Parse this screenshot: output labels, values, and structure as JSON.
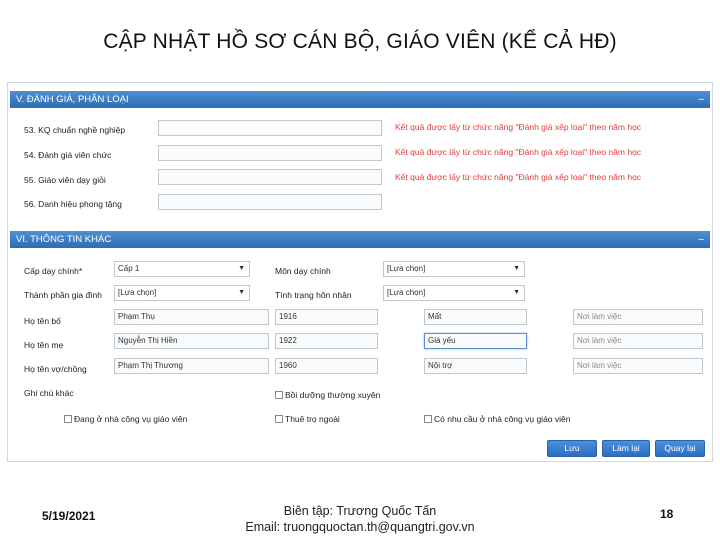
{
  "slide": {
    "title": "CẬP NHẬT HỒ SƠ CÁN BỘ, GIÁO VIÊN (KỂ CẢ HĐ)",
    "footer_date": "5/19/2021",
    "footer_editor": "Biên tập: Trương Quốc Tấn",
    "footer_email": "Email: truongquoctan.th@quangtri.gov.vn",
    "page_number": "18"
  },
  "section5": {
    "title": "V. ĐÁNH GIÁ, PHÂN LOẠI",
    "collapse": "–",
    "fields": [
      {
        "label": "53. KQ chuẩn nghề nghiệp",
        "note": "Kết quả được lấy từ chức năng \"Đánh giá xếp loại\" theo năm học"
      },
      {
        "label": "54. Đánh giá viên chức",
        "note": "Kết quả được lấy từ chức năng \"Đánh giá xếp loại\" theo năm học"
      },
      {
        "label": "55. Giáo viên dạy giỏi",
        "note": "Kết quả được lấy từ chức năng \"Đánh giá xếp loại\" theo năm học"
      },
      {
        "label": "56. Danh hiệu phong tặng",
        "note": ""
      }
    ]
  },
  "section6": {
    "title": "VI. THÔNG TIN KHÁC",
    "collapse": "–",
    "left_selects": [
      {
        "label": "Cấp dạy chính*",
        "value": "Cấp 1"
      },
      {
        "label": "Thành phần gia đình",
        "value": "[Lựa chọn]"
      }
    ],
    "right_selects": [
      {
        "label": "Môn dạy chính",
        "value": "[Lựa chọn]"
      },
      {
        "label": "Tình trạng hôn nhân",
        "value": "[Lựa chọn]"
      }
    ],
    "family": [
      {
        "label": "Họ tên bố",
        "name": "Phạm Thụ",
        "year": "1916",
        "status": "Mất",
        "work_placeholder": "Nơi làm việc"
      },
      {
        "label": "Họ tên mẹ",
        "name": "Nguyễn Thị Hiền",
        "year": "1922",
        "status": "Già yếu",
        "work_placeholder": "Nơi làm việc"
      },
      {
        "label": "Họ tên vợ/chồng",
        "name": "Phạm Thị Thương",
        "year": "1960",
        "status": "Nội trợ",
        "work_placeholder": "Nơi làm việc"
      }
    ],
    "note_label": "Ghi chú khác",
    "checkboxes": {
      "training": "Bồi dưỡng thường xuyên",
      "house": "Đang ở nhà công vụ giáo viên",
      "rent": "Thuê trọ ngoài",
      "need_house": "Có nhu cầu ở nhà công vụ giáo viên"
    }
  },
  "buttons": {
    "save": "Lưu",
    "reset": "Làm lại",
    "back": "Quay lại"
  }
}
